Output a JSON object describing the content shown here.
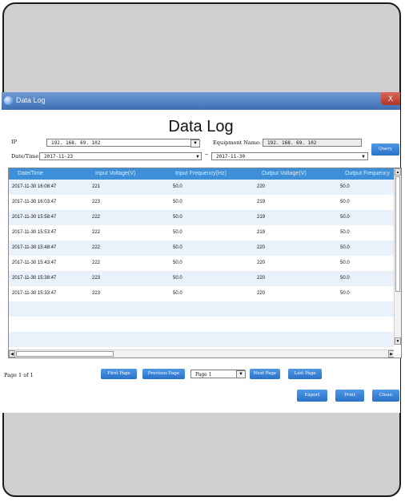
{
  "window": {
    "title": "Data Log",
    "close_label": "X"
  },
  "heading": "Data Log",
  "filters": {
    "ip_label": "IP",
    "ip_value": "192. 168. 69. 102",
    "equipment_label": "Equipment Name:",
    "equipment_value": "192. 168. 69. 102",
    "datetime_label": "Date/Time",
    "date_from": "2017-11-23",
    "range_separator": "~",
    "date_to": "2017-11-30",
    "query_label": "Query"
  },
  "table": {
    "columns": [
      "Date/Time",
      "Input Voltage(V)",
      "Input Frequency(Hz)",
      "Output Voltage(V)",
      "Output Frequency"
    ],
    "rows": [
      [
        "2017-11-30 16:08:47",
        "221",
        "50.0",
        "220",
        "50.0"
      ],
      [
        "2017-11-30 16:03:47",
        "223",
        "50.0",
        "219",
        "50.0"
      ],
      [
        "2017-11-30 15:58:47",
        "222",
        "50.0",
        "219",
        "50.0"
      ],
      [
        "2017-11-30 15:53:47",
        "222",
        "50.0",
        "219",
        "50.0"
      ],
      [
        "2017-11-30 15:48:47",
        "222",
        "50.0",
        "220",
        "50.0"
      ],
      [
        "2017-11-30 15:43:47",
        "222",
        "50.0",
        "220",
        "50.0"
      ],
      [
        "2017-11-30 15:38:47",
        "223",
        "50.0",
        "220",
        "50.0"
      ],
      [
        "2017-11-30 15:33:47",
        "223",
        "50.0",
        "220",
        "50.0"
      ]
    ]
  },
  "pager": {
    "info": "Page 1 of 1",
    "first": "First Page",
    "previous": "Previous Page",
    "page_select": "Page 1",
    "next": "Next Page",
    "last": "Last Page"
  },
  "actions": {
    "export": "Export",
    "print": "Print",
    "clean": "Clean"
  },
  "glyphs": {
    "dropdown": "▼",
    "up": "▲",
    "down": "▼",
    "left": "◀",
    "right": "▶"
  }
}
